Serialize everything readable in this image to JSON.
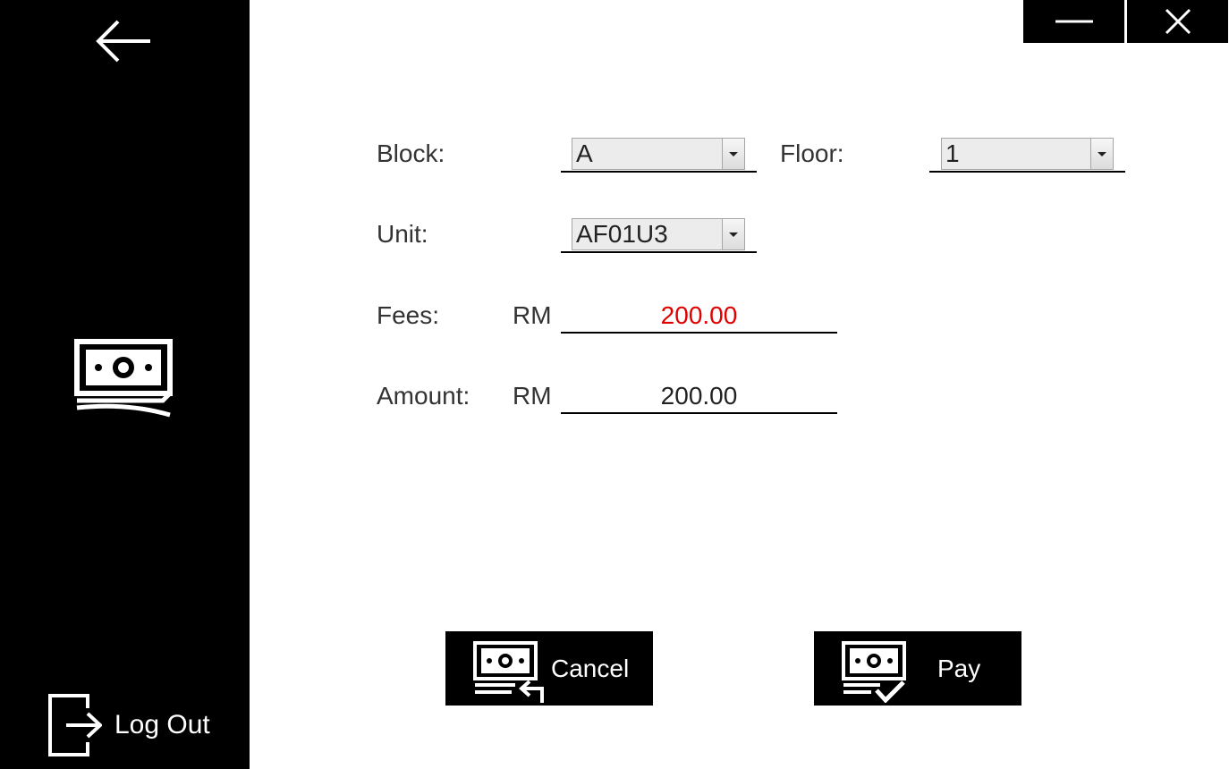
{
  "form": {
    "block_label": "Block:",
    "block_value": "A",
    "floor_label": "Floor:",
    "floor_value": "1",
    "unit_label": "Unit:",
    "unit_value": "AF01U3",
    "fees_label": "Fees:",
    "fees_currency": "RM",
    "fees_value": "200.00",
    "amount_label": "Amount:",
    "amount_currency": "RM",
    "amount_value": "200.00"
  },
  "actions": {
    "cancel_label": "Cancel",
    "pay_label": "Pay"
  },
  "sidebar": {
    "logout_label": "Log Out"
  },
  "colors": {
    "sidebar_bg": "#000000",
    "fees_value_color": "#e00000"
  },
  "icons": [
    "back-arrow-icon",
    "money-icon",
    "logout-icon",
    "minimize-icon",
    "close-icon",
    "money-return-icon",
    "money-check-icon"
  ]
}
